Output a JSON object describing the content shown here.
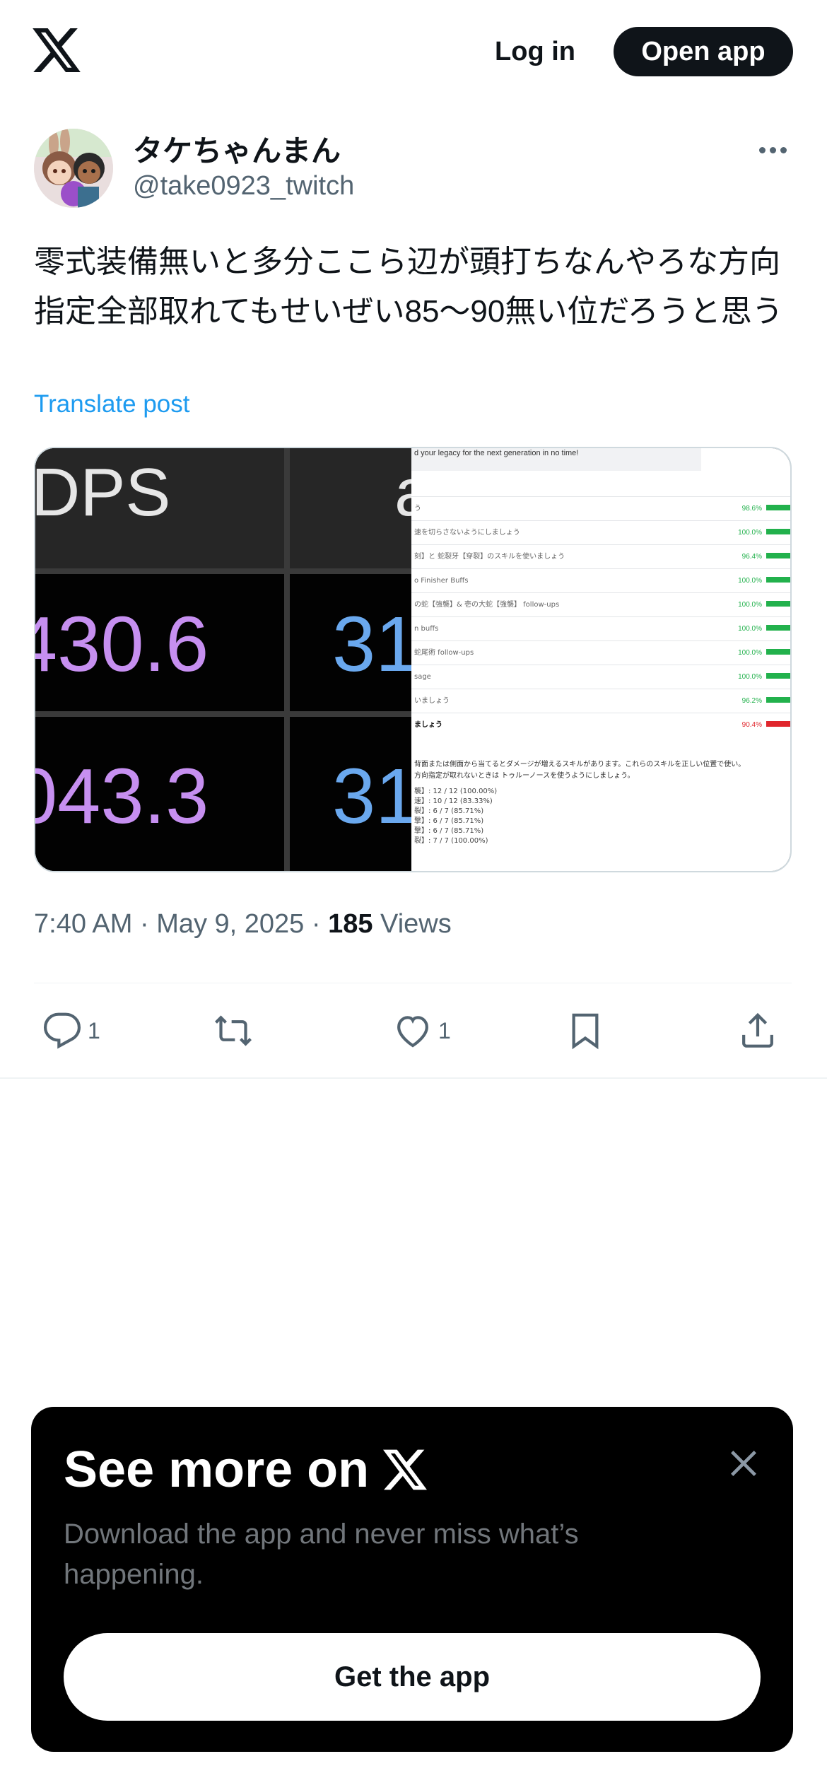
{
  "header": {
    "login_label": "Log in",
    "open_app_label": "Open app"
  },
  "author": {
    "name": "タケちゃんまん",
    "handle": "@take0923_twitch"
  },
  "post": {
    "text": "零式装備無いと多分ここら辺が頭打ちなんやろな方向指定全部取れてもせいぜい85〜90無い位だろうと思う",
    "translate_label": "Translate post"
  },
  "media": {
    "left": {
      "header": "DPS",
      "header2": "a",
      "row1": "430.6",
      "row1b": "31",
      "row2": "043.3",
      "row2b": "31"
    },
    "right": {
      "banner": "d your legacy for the next generation in no time!",
      "rows": [
        {
          "label": "う",
          "pct": "98.6%"
        },
        {
          "label": "速を切らさないようにしましょう",
          "pct": "100.0%"
        },
        {
          "label": "刻】と 蛇裂牙【穿裂】のスキルを使いましょう",
          "pct": "96.4%"
        },
        {
          "label": "o Finisher Buffs",
          "pct": "100.0%"
        },
        {
          "label": "の蛇【強襲】& 壱の大蛇【強襲】 follow-ups",
          "pct": "100.0%"
        },
        {
          "label": "n buffs",
          "pct": "100.0%"
        },
        {
          "label": "蛇尾術 follow-ups",
          "pct": "100.0%"
        },
        {
          "label": "sage",
          "pct": "100.0%"
        },
        {
          "label": "いましょう",
          "pct": "96.2%"
        },
        {
          "label": "ましょう",
          "pct": "90.4%"
        }
      ],
      "note1": "背面または側面から当てるとダメージが増えるスキルがあります。これらのスキルを正しい位置で使い。",
      "note2": "方向指定が取れないときは トゥルーノースを使うようにしましょう。",
      "stats": [
        "襲】: 12 / 12 (100.00%)",
        "速】: 10 / 12 (83.33%)",
        "裂】: 6 / 7 (85.71%)",
        "撃】: 6 / 7 (85.71%)",
        "撃】: 6 / 7 (85.71%)",
        "裂】: 7 / 7 (100.00%)"
      ]
    }
  },
  "meta": {
    "time": "7:40 AM · May 9, 2025 · ",
    "views_count": "185",
    "views_label": " Views"
  },
  "actions": {
    "replies": "1",
    "likes": "1"
  },
  "promo": {
    "title": "See more on",
    "subtitle": "Download the app and never miss what’s happening.",
    "button": "Get the app"
  },
  "colors": {
    "accent": "#1d9bf0",
    "text": "#0f1419",
    "secondary": "#536471",
    "good": "#22b14c",
    "bad": "#e0262c"
  },
  "icons": [
    "x-logo-icon",
    "more-icon",
    "reply-icon",
    "repost-icon",
    "like-icon",
    "bookmark-icon",
    "share-icon",
    "close-icon"
  ]
}
